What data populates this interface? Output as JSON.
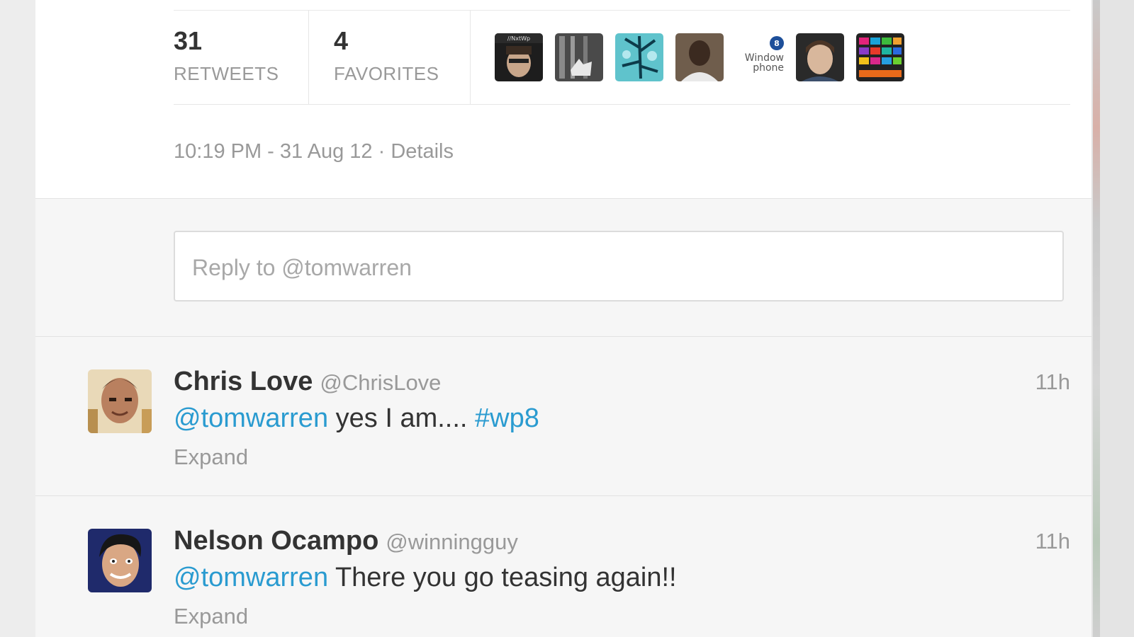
{
  "stats": {
    "retweets_count": "31",
    "retweets_label": "RETWEETS",
    "favorites_count": "4",
    "favorites_label": "FAVORITES"
  },
  "favoriters": [
    {
      "name": "avatar-1",
      "caption": "//NxtWp"
    },
    {
      "name": "avatar-2"
    },
    {
      "name": "avatar-3"
    },
    {
      "name": "avatar-4"
    },
    {
      "name": "avatar-5",
      "caption": "Window phone"
    },
    {
      "name": "avatar-6"
    },
    {
      "name": "avatar-7"
    }
  ],
  "tweet_meta": {
    "timestamp": "10:19 PM - 31 Aug 12",
    "separator": " · ",
    "details_link": "Details"
  },
  "reply": {
    "placeholder": "Reply to @tomwarren"
  },
  "replies": [
    {
      "name": "Chris Love",
      "handle": "@ChrisLove",
      "time": "11h",
      "mention": "@tomwarren",
      "text": " yes I am.... ",
      "hashtag": "#wp8",
      "expand": "Expand"
    },
    {
      "name": "Nelson Ocampo",
      "handle": "@winningguy",
      "time": "11h",
      "mention": "@tomwarren",
      "text": " There you go teasing again!!",
      "expand": "Expand"
    }
  ],
  "colors": {
    "link": "#2a9bd0",
    "text": "#333333",
    "muted": "#999999"
  }
}
